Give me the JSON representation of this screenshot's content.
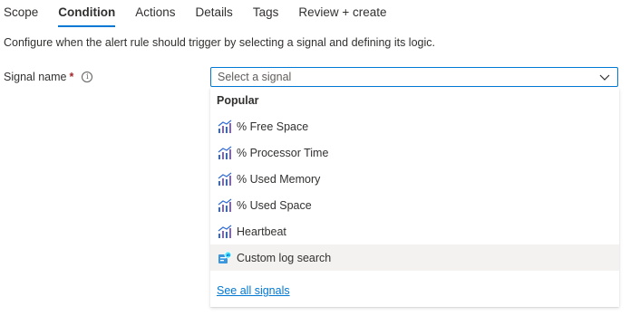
{
  "tabs": [
    {
      "label": "Scope",
      "active": false
    },
    {
      "label": "Condition",
      "active": true
    },
    {
      "label": "Actions",
      "active": false
    },
    {
      "label": "Details",
      "active": false
    },
    {
      "label": "Tags",
      "active": false
    },
    {
      "label": "Review + create",
      "active": false
    }
  ],
  "description": "Configure when the alert rule should trigger by selecting a signal and defining its logic.",
  "signal_field": {
    "label": "Signal name",
    "required_marker": "*",
    "info_glyph": "i",
    "placeholder": "Select a signal"
  },
  "dropdown": {
    "group_header": "Popular",
    "options": [
      {
        "label": "% Free Space",
        "icon": "metric-chart-icon"
      },
      {
        "label": "% Processor Time",
        "icon": "metric-chart-icon"
      },
      {
        "label": "% Used Memory",
        "icon": "metric-chart-icon"
      },
      {
        "label": "% Used Space",
        "icon": "metric-chart-icon"
      },
      {
        "label": "Heartbeat",
        "icon": "metric-chart-icon"
      },
      {
        "label": "Custom log search",
        "icon": "log-search-icon"
      }
    ],
    "see_all_link": "See all signals"
  },
  "colors": {
    "accent": "#0078d4",
    "required": "#a4262c",
    "hover_row": "#f3f2f1",
    "metric_icon_blue": "#2f6bd8",
    "metric_icon_purple": "#8661c5"
  }
}
